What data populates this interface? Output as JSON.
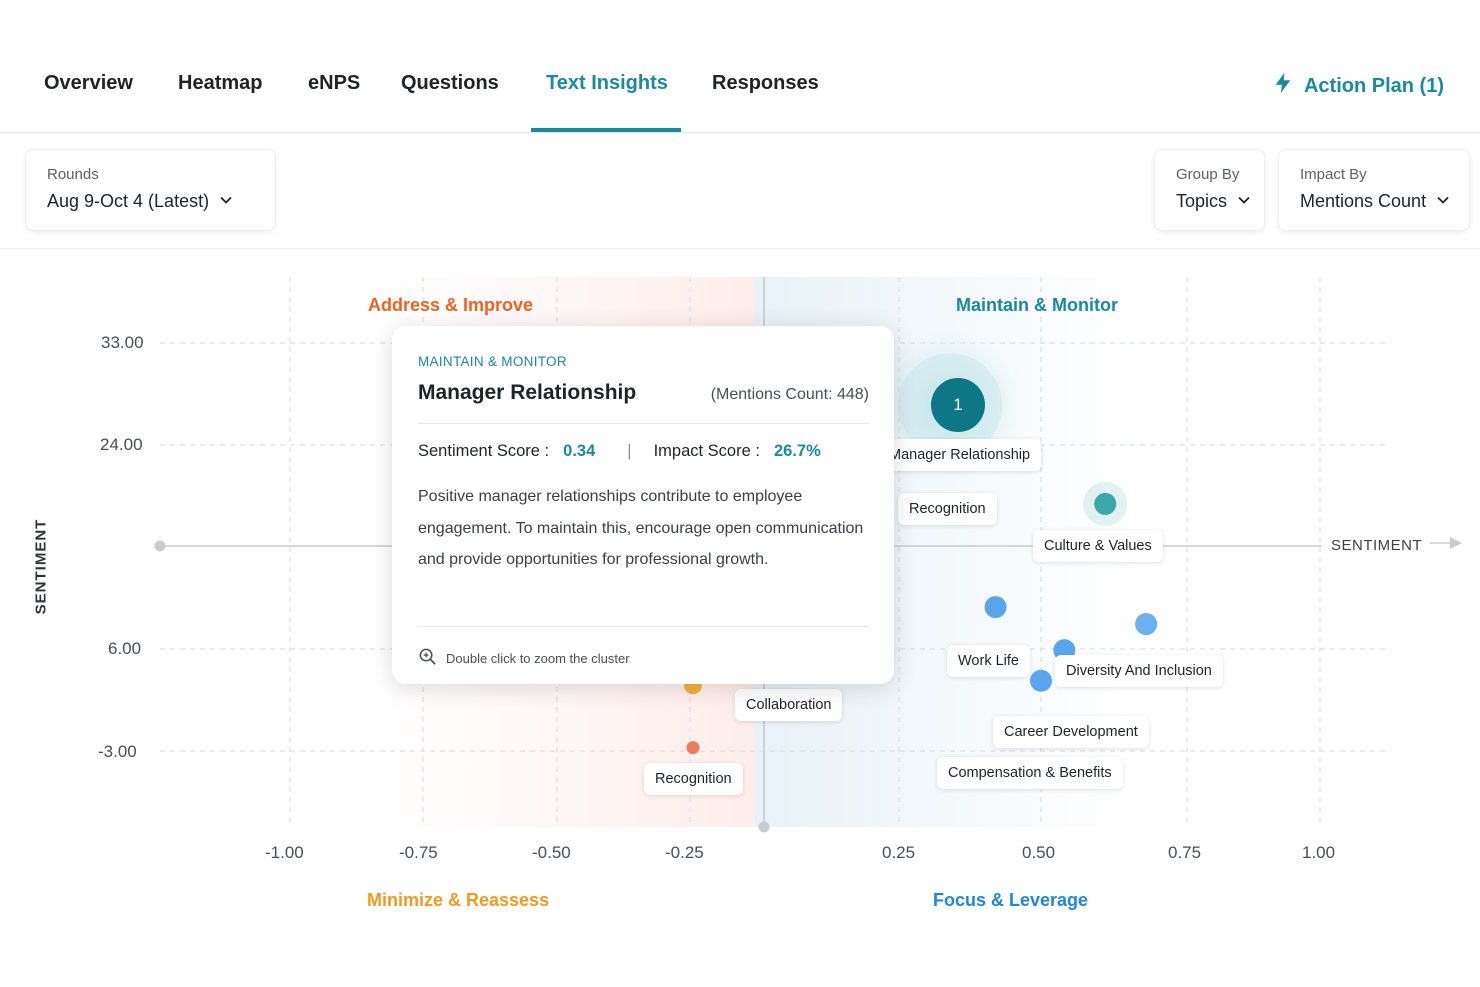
{
  "tabs": [
    {
      "label": "Overview"
    },
    {
      "label": "Heatmap"
    },
    {
      "label": "eNPS"
    },
    {
      "label": "Questions"
    },
    {
      "label": "Text Insights",
      "active": true
    },
    {
      "label": "Responses"
    }
  ],
  "action_plan": {
    "label": "Action Plan (1)",
    "icon": "lightning-icon"
  },
  "filters": {
    "rounds": {
      "label": "Rounds",
      "value": "Aug 9-Oct 4 (Latest)"
    },
    "group_by": {
      "label": "Group By",
      "value": "Topics"
    },
    "impact_by": {
      "label": "Impact By",
      "value": "Mentions Count"
    }
  },
  "chart": {
    "y_axis_title": "SENTIMENT",
    "x_axis_title": "SENTIMENT",
    "y_ticks": [
      "33.00",
      "24.00",
      "6.00",
      "-3.00"
    ],
    "x_ticks": [
      "-1.00",
      "-0.75",
      "-0.50",
      "-0.25",
      "0.25",
      "0.50",
      "0.75",
      "1.00"
    ],
    "quadrants": {
      "top_left": "Address & Improve",
      "top_right": "Maintain & Monitor",
      "bottom_left": "Minimize & Reassess",
      "bottom_right": "Focus & Leverage"
    },
    "cluster_badge": "1"
  },
  "chart_data": {
    "type": "scatter",
    "title": "",
    "xlabel": "SENTIMENT",
    "ylabel": "SENTIMENT",
    "xlim": [
      -1.0,
      1.0
    ],
    "ylim": [
      -9,
      36
    ],
    "x_ticks": [
      -1.0,
      -0.75,
      -0.5,
      -0.25,
      0.25,
      0.5,
      0.75,
      1.0
    ],
    "y_ticks": [
      33.0,
      24.0,
      6.0,
      -3.0
    ],
    "grid": true,
    "points": [
      {
        "label": "Manager Relationship",
        "x": 0.34,
        "y": 27.5,
        "color": "#0f7f8f",
        "cluster": true
      },
      {
        "label": "Recognition",
        "x": 0.18,
        "y": 20.8,
        "color": "#2aa7b5"
      },
      {
        "label": "Culture & Values",
        "x": 0.61,
        "y": 18.8,
        "color": "#38a8a8"
      },
      {
        "label": "Work Life",
        "x": 0.42,
        "y": 9.7,
        "color": "#5aa6ee"
      },
      {
        "label": "Diversity And Inclusion",
        "x": 0.54,
        "y": 5.9,
        "color": "#5aa6ee"
      },
      {
        "label": "Career Development",
        "x": 0.5,
        "y": 3.2,
        "color": "#5aa6ee"
      },
      {
        "label": "Compensation & Benefits",
        "x": 0.68,
        "y": 8.2,
        "color": "#6ab0f0"
      },
      {
        "label": "Collaboration",
        "x": -0.24,
        "y": 2.8,
        "color": "#f5b13d"
      },
      {
        "label": "Recognition",
        "x": -0.24,
        "y": -2.7,
        "color": "#f07a5e"
      }
    ],
    "colors": {
      "teal": "#1a8a9c",
      "orange_red": "#f2621f",
      "orange": "#f39a1d",
      "blue": "#1f86e0"
    }
  },
  "tooltip": {
    "quadrant": "MAINTAIN & MONITOR",
    "title": "Manager Relationship",
    "count": "(Mentions Count: 448)",
    "sentiment_label": "Sentiment Score :",
    "sentiment_value": "0.34",
    "separator": "|",
    "impact_label": "Impact Score :",
    "impact_value": "26.7%",
    "description": "Positive manager relationships contribute to employee engagement. To maintain this, encourage open communication and provide opportunities for professional growth.",
    "footer": "Double click to zoom the cluster"
  },
  "labels": {
    "manager_relationship": "Manager Relationship",
    "recognition_pos": "Recognition",
    "culture_values": "Culture & Values",
    "work_life": "Work Life",
    "diversity": "Diversity And Inclusion",
    "career": "Career Development",
    "compensation": "Compensation & Benefits",
    "collaboration": "Collaboration",
    "recognition_neg": "Recognition"
  }
}
